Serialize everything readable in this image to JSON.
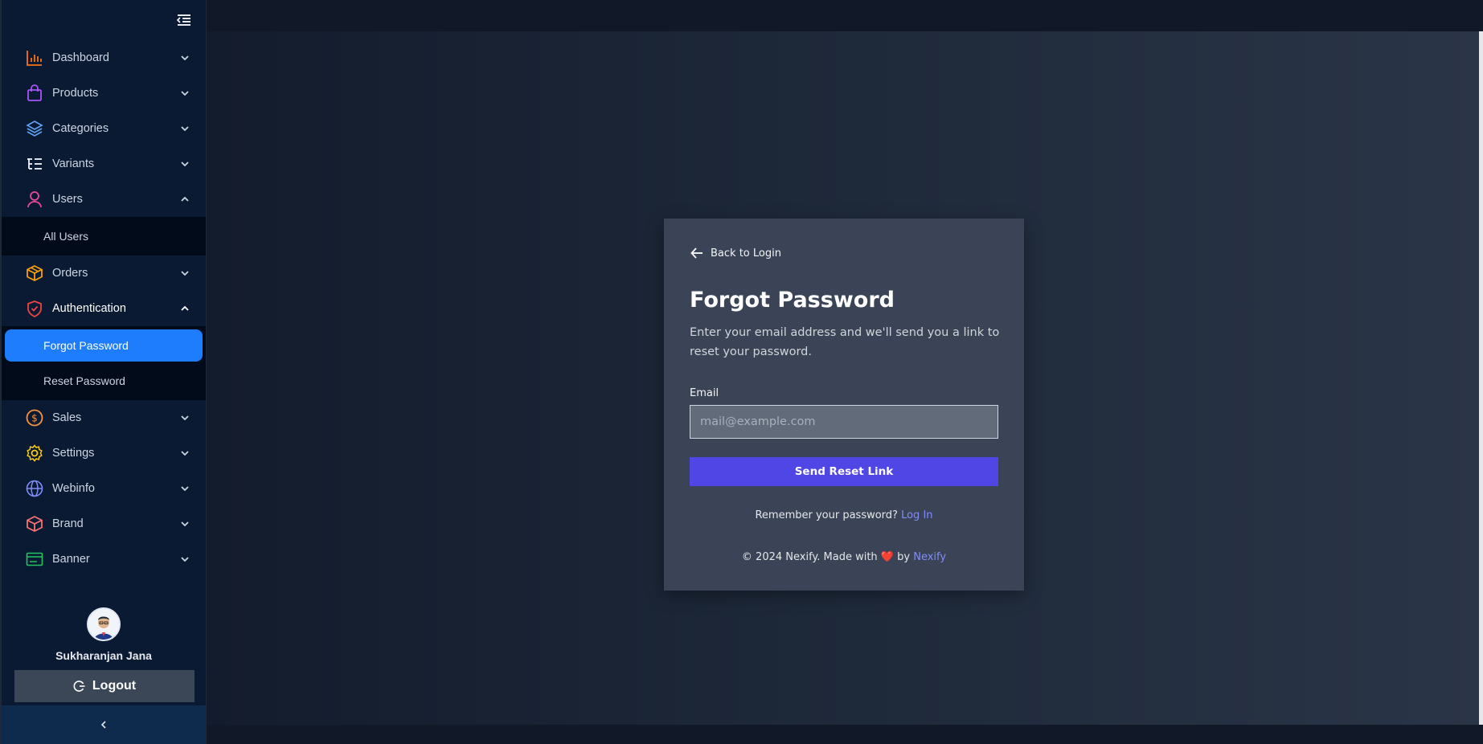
{
  "sidebar": {
    "items": [
      {
        "label": "Dashboard",
        "icon": "chart-bar-icon",
        "color": "#f97316"
      },
      {
        "label": "Products",
        "icon": "shopping-bag-icon",
        "color": "#a855f7"
      },
      {
        "label": "Categories",
        "icon": "layers-icon",
        "color": "#60a5fa"
      },
      {
        "label": "Variants",
        "icon": "list-tree-icon",
        "color": "#f1f5f9"
      },
      {
        "label": "Users",
        "icon": "user-icon",
        "color": "#ec4899",
        "sub": [
          "All Users"
        ]
      },
      {
        "label": "Orders",
        "icon": "box-icon",
        "color": "#f59e0b"
      },
      {
        "label": "Authentication",
        "icon": "shield-check-icon",
        "color": "#ef4444",
        "sub": [
          "Forgot Password",
          "Reset Password"
        ]
      },
      {
        "label": "Sales",
        "icon": "dollar-circle-icon",
        "color": "#fb923c"
      },
      {
        "label": "Settings",
        "icon": "gear-icon",
        "color": "#facc15"
      },
      {
        "label": "Webinfo",
        "icon": "globe-icon",
        "color": "#818cf8"
      },
      {
        "label": "Brand",
        "icon": "package-icon",
        "color": "#f87171"
      },
      {
        "label": "Banner",
        "icon": "banner-icon",
        "color": "#22c55e"
      }
    ],
    "active_sub": "Forgot Password",
    "user_name": "Sukharanjan Jana",
    "logout_label": "Logout"
  },
  "card": {
    "back_label": "Back to Login",
    "title": "Forgot Password",
    "description": "Enter your email address and we'll send you a link to reset your password.",
    "email_label": "Email",
    "email_placeholder": "mail@example.com",
    "email_value": "",
    "submit_label": "Send Reset Link",
    "remember_text": "Remember your password?",
    "login_link": "Log In",
    "footer_prefix": "© 2024 Nexify. Made with",
    "footer_heart": "❤️",
    "footer_by": "by",
    "footer_link": "Nexify"
  },
  "colors": {
    "accent": "#4f46e5",
    "active_nav": "#1d7dfc",
    "link": "#818cf8"
  }
}
